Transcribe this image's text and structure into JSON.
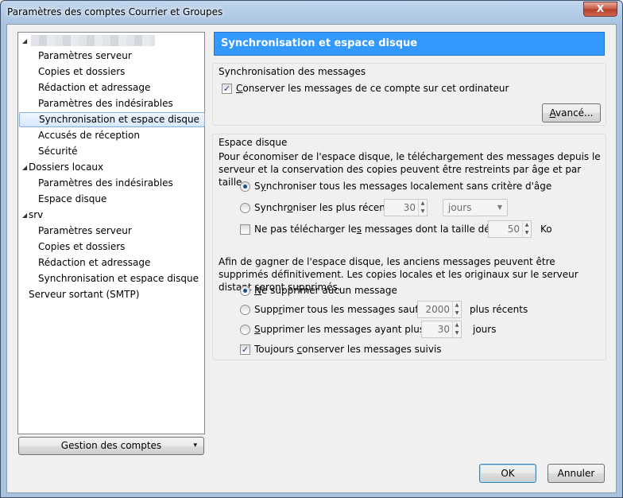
{
  "window": {
    "title": "Paramètres des comptes Courrier et Groupes",
    "close_label": "X"
  },
  "tree": {
    "items": [
      {
        "label": "",
        "level": 0,
        "expanded": true
      },
      {
        "label": "Paramètres serveur",
        "level": 1
      },
      {
        "label": "Copies et dossiers",
        "level": 1
      },
      {
        "label": "Rédaction et adressage",
        "level": 1
      },
      {
        "label": "Paramètres des indésirables",
        "level": 1
      },
      {
        "label": "Synchronisation et espace disque",
        "level": 1,
        "selected": true
      },
      {
        "label": "Accusés de réception",
        "level": 1
      },
      {
        "label": "Sécurité",
        "level": 1
      },
      {
        "label": "Dossiers locaux",
        "level": 0,
        "expanded": true
      },
      {
        "label": "Paramètres des indésirables",
        "level": 1
      },
      {
        "label": "Espace disque",
        "level": 1
      },
      {
        "label": "srv",
        "level": 0,
        "expanded": true
      },
      {
        "label": "Paramètres serveur",
        "level": 1
      },
      {
        "label": "Copies et dossiers",
        "level": 1
      },
      {
        "label": "Rédaction et adressage",
        "level": 1
      },
      {
        "label": "Synchronisation et espace disque",
        "level": 1
      },
      {
        "label": "Serveur sortant (SMTP)",
        "level": 0
      }
    ]
  },
  "account_button": {
    "label": "Gestion des comptes",
    "arrow": "▾"
  },
  "panel": {
    "title": "Synchronisation et espace disque",
    "sync_group": {
      "title": "Synchronisation des messages",
      "keep_checkbox": {
        "label_u": "C",
        "label": "onserver les messages de ce compte sur cet ordinateur",
        "checked": true
      },
      "advanced_button": {
        "label_u": "A",
        "label": "vancé..."
      }
    },
    "disk_group": {
      "title": "Espace disque",
      "description": "Pour économiser de l'espace disque, le téléchargement des messages depuis le serveur et la conservation des copies peuvent être restreints par âge et par taille.",
      "sync_all": {
        "pre": "S",
        "u": "y",
        "post": "nchroniser tous les messages localement sans critère d'âge",
        "checked": true
      },
      "sync_recent": {
        "pre": "Synchr",
        "u": "o",
        "post": "niser les plus récents",
        "checked": false,
        "value": "30",
        "unit": "jours"
      },
      "no_download": {
        "pre": "Ne pas télécharger le",
        "u": "s",
        "post": " messages dont la taille dépasse",
        "checked": false,
        "value": "50",
        "unit": "Ko"
      },
      "description2": "Afin de gagner de l'espace disque, les anciens messages peuvent être supprimés définitivement. Les copies locales et les originaux sur le serveur distant seront supprimés.",
      "delete_none": {
        "u": "N",
        "post": "e supprimer aucun message",
        "checked": true
      },
      "delete_except": {
        "pre": "Supp",
        "u": "r",
        "post": "imer tous les messages sauf les",
        "checked": false,
        "value": "2000",
        "unit": "plus récents"
      },
      "delete_older": {
        "u": "S",
        "post": "upprimer les messages ayant plus de",
        "checked": false,
        "value": "30",
        "unit": "jours"
      },
      "keep_flagged": {
        "pre": "Toujours ",
        "u": "c",
        "post": "onserver les messages suivis",
        "checked": true
      }
    }
  },
  "footer": {
    "ok_label": "OK",
    "cancel_label": "Annuler"
  }
}
